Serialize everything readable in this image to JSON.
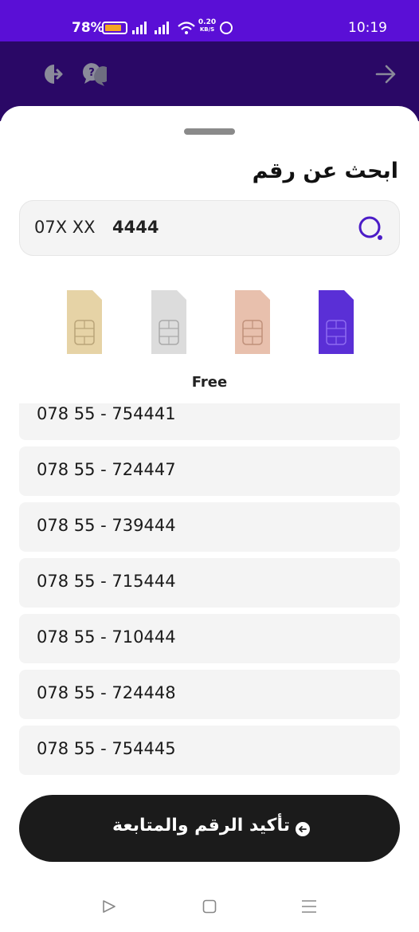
{
  "status_bar": {
    "battery_percent": "78%",
    "network_speed_value": "0.20",
    "network_speed_unit": "KB/S",
    "time": "10:19"
  },
  "header": {
    "left_icons": [
      "exit-icon",
      "help-icon"
    ],
    "right_icon": "back-arrow-icon",
    "background_color": "#2a0866",
    "status_color": "#5a0fd6"
  },
  "sheet": {
    "title": "ابحث عن رقم",
    "search": {
      "prefix": "07X XX",
      "value": "4444",
      "icon": "search-icon"
    },
    "sim_options": [
      {
        "name": "gold-sim",
        "color": "#e6d3a6"
      },
      {
        "name": "silver-sim",
        "color": "#dcdcdc"
      },
      {
        "name": "rose-gold-sim",
        "color": "#e8c0ad"
      },
      {
        "name": "purple-sim",
        "color": "#5a2fd6"
      }
    ],
    "selected_sim_label": "Free",
    "numbers": [
      "078 55 - 754441",
      "078 55 - 724447",
      "078 55 - 739444",
      "078 55 - 715444",
      "078 55 - 710444",
      "078 55 - 724448",
      "078 55 - 754445"
    ],
    "confirm_button": "تأكيد الرقم والمتابعة"
  },
  "nav_bar": {
    "icons": [
      "back-triangle-icon",
      "home-square-icon",
      "menu-lines-icon"
    ]
  }
}
